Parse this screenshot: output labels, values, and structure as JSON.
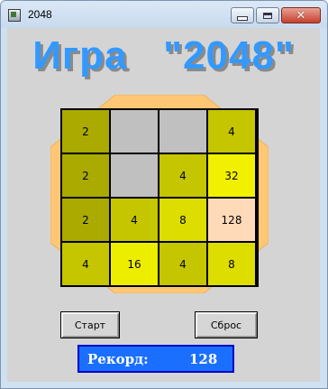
{
  "window": {
    "title": "2048",
    "icon": "app-icon",
    "controls": [
      "minimize-icon",
      "maximize-icon",
      "close-icon"
    ]
  },
  "game": {
    "title": "Игра   \"2048\"",
    "title_color": "#3399ff",
    "board_border_color": "#ffc773",
    "board": [
      [
        {
          "v": "2",
          "c": "#aaaa00"
        },
        {
          "v": "",
          "c": "#c0c0c0"
        },
        {
          "v": "",
          "c": "#c0c0c0"
        },
        {
          "v": "4",
          "c": "#c5c500"
        }
      ],
      [
        {
          "v": "2",
          "c": "#aaaa00"
        },
        {
          "v": "",
          "c": "#c0c0c0"
        },
        {
          "v": "4",
          "c": "#c5c500"
        },
        {
          "v": "32",
          "c": "#f0f000"
        }
      ],
      [
        {
          "v": "2",
          "c": "#aaaa00"
        },
        {
          "v": "4",
          "c": "#c5c500"
        },
        {
          "v": "8",
          "c": "#dddd00"
        },
        {
          "v": "128",
          "c": "#ffdab9"
        }
      ],
      [
        {
          "v": "4",
          "c": "#c5c500"
        },
        {
          "v": "16",
          "c": "#eded00"
        },
        {
          "v": "4",
          "c": "#c5c500"
        },
        {
          "v": "8",
          "c": "#dddd00"
        }
      ]
    ]
  },
  "buttons": {
    "start_label": "Старт",
    "reset_label": "Сброс"
  },
  "record": {
    "label": "Рекорд:",
    "value": "128",
    "bg_color": "#1a6fff"
  }
}
